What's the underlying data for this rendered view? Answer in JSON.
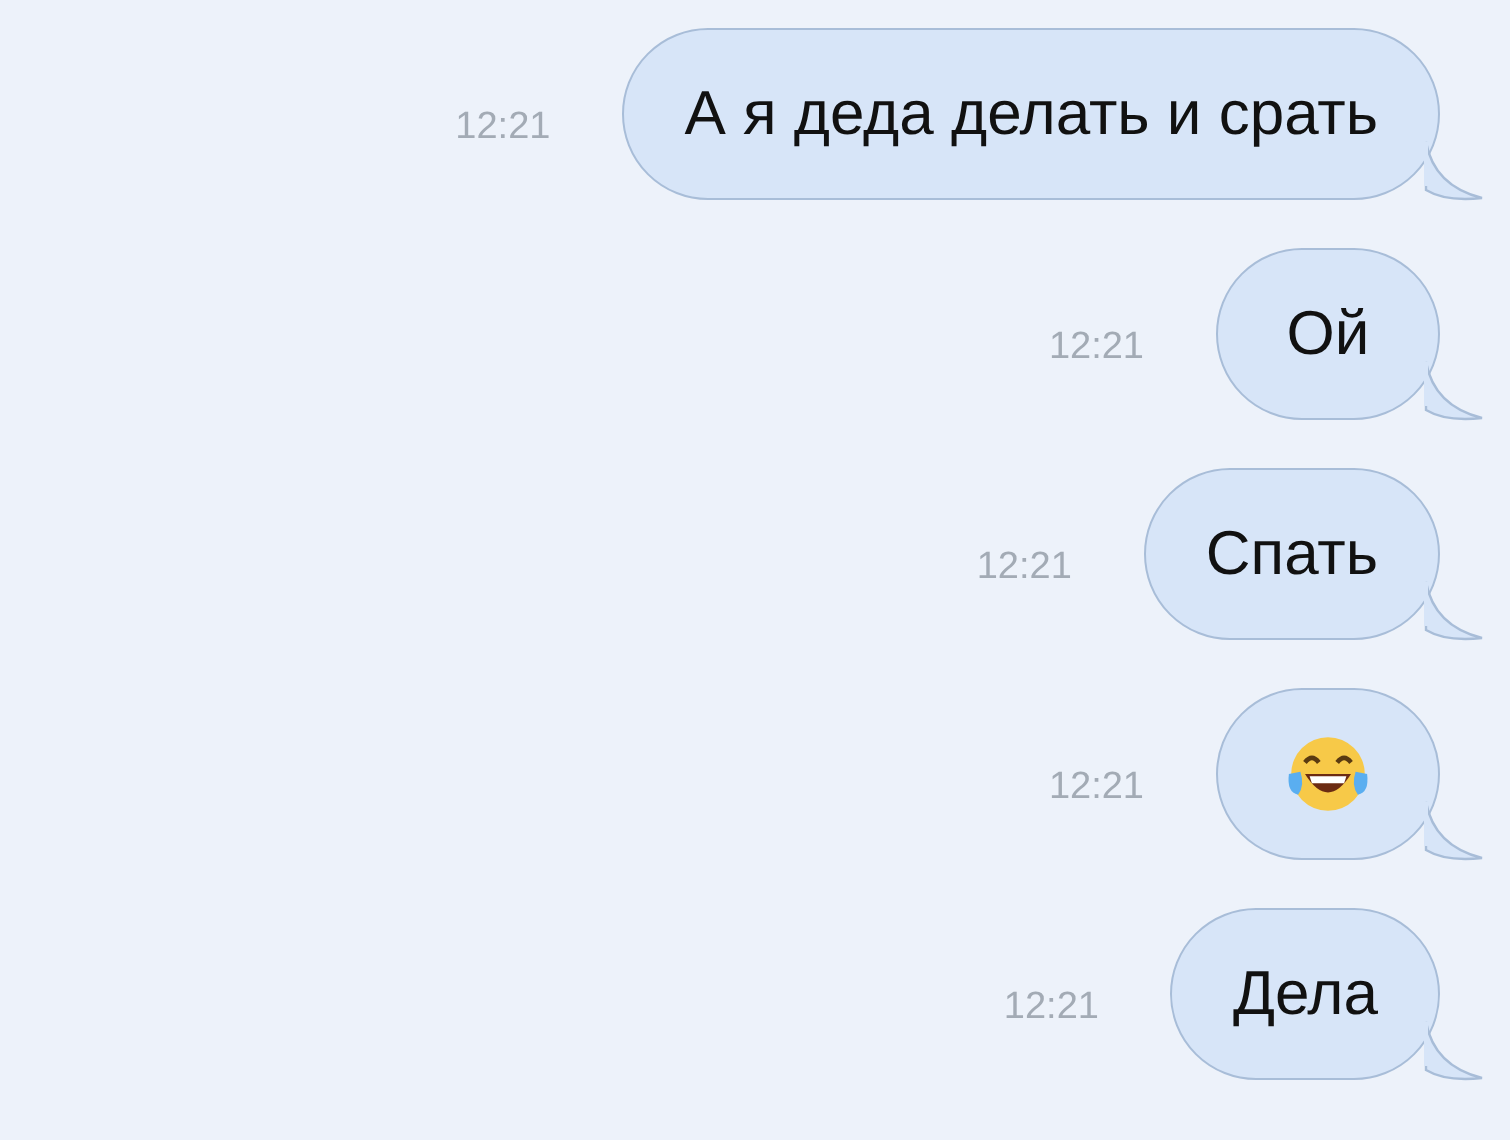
{
  "messages": [
    {
      "time": "12:21",
      "kind": "text",
      "text": "А я деда делать и срать"
    },
    {
      "time": "12:21",
      "kind": "text",
      "text": "Ой"
    },
    {
      "time": "12:21",
      "kind": "text",
      "text": "Спать"
    },
    {
      "time": "12:21",
      "kind": "emoji"
    },
    {
      "time": "12:21",
      "kind": "text",
      "text": "Дела"
    }
  ]
}
